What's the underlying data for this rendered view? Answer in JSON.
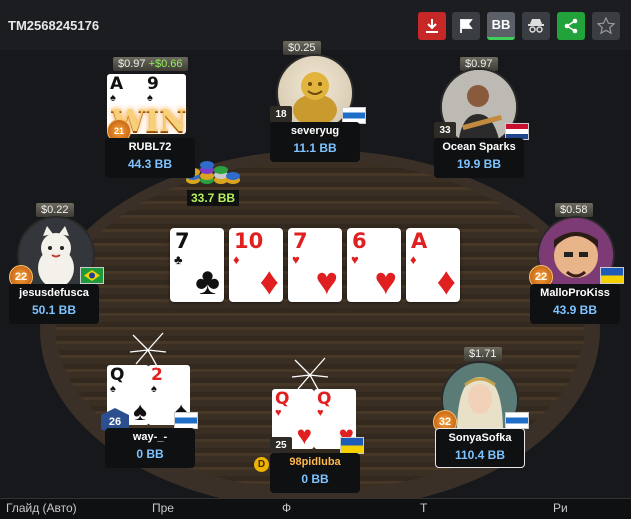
{
  "hand_id": "TM2568245176",
  "toolbar": {
    "download_icon": "download-icon",
    "flag_icon": "flag-icon",
    "bb_label": "BB",
    "spy_icon": "spy-icon",
    "share_icon": "share-icon",
    "star_icon": "star-icon",
    "colors": {
      "download": "#c62828",
      "share": "#22a23a",
      "dark": "#3a3d42"
    }
  },
  "pot": {
    "amount": "33.7 BB"
  },
  "board": [
    {
      "rank": "7",
      "suit": "♣",
      "color": "black"
    },
    {
      "rank": "10",
      "suit": "♦",
      "color": "red"
    },
    {
      "rank": "7",
      "suit": "♥",
      "color": "red"
    },
    {
      "rank": "6",
      "suit": "♥",
      "color": "red"
    },
    {
      "rank": "A",
      "suit": "♦",
      "color": "red"
    }
  ],
  "players": {
    "rubl72": {
      "name": "RUBL72",
      "stack": "44.3 BB",
      "bet": "$0.97",
      "win_amount": "+$0.66",
      "win_label": "WIN",
      "level": "21",
      "cards": [
        {
          "rank": "A",
          "suit": "♠"
        },
        {
          "rank": "9",
          "suit": "♠"
        }
      ]
    },
    "severyug": {
      "name": "severyug",
      "stack": "11.1 BB",
      "bet": "$0.25",
      "level": "18"
    },
    "ocean": {
      "name": "Ocean Sparks",
      "stack": "19.9 BB",
      "bet": "$0.97",
      "level": "33"
    },
    "jesus": {
      "name": "jesusdefusca",
      "stack": "50.1 BB",
      "bet": "$0.22",
      "level": "22"
    },
    "mallo": {
      "name": "MalloProKiss",
      "stack": "43.9 BB",
      "bet": "$0.58",
      "level": "22"
    },
    "way": {
      "name": "way-_-",
      "stack": "0 BB",
      "level": "26",
      "cards": [
        {
          "rank": "Q",
          "suit": "♠"
        },
        {
          "rank": "2",
          "suit": "♠"
        }
      ]
    },
    "pidluba": {
      "name": "98pidluba",
      "stack": "0 BB",
      "level": "25",
      "dealer": "D",
      "cards": [
        {
          "rank": "Q",
          "suit": "♥"
        },
        {
          "rank": "Q",
          "suit": "♥"
        }
      ]
    },
    "sonya": {
      "name": "SonyaSofka",
      "stack": "110.4 BB",
      "bet": "$1.71",
      "level": "32"
    }
  },
  "bottom_tabs": [
    "Глайд (Авто)",
    "Пре",
    "Ф",
    "Т",
    "Ри"
  ]
}
